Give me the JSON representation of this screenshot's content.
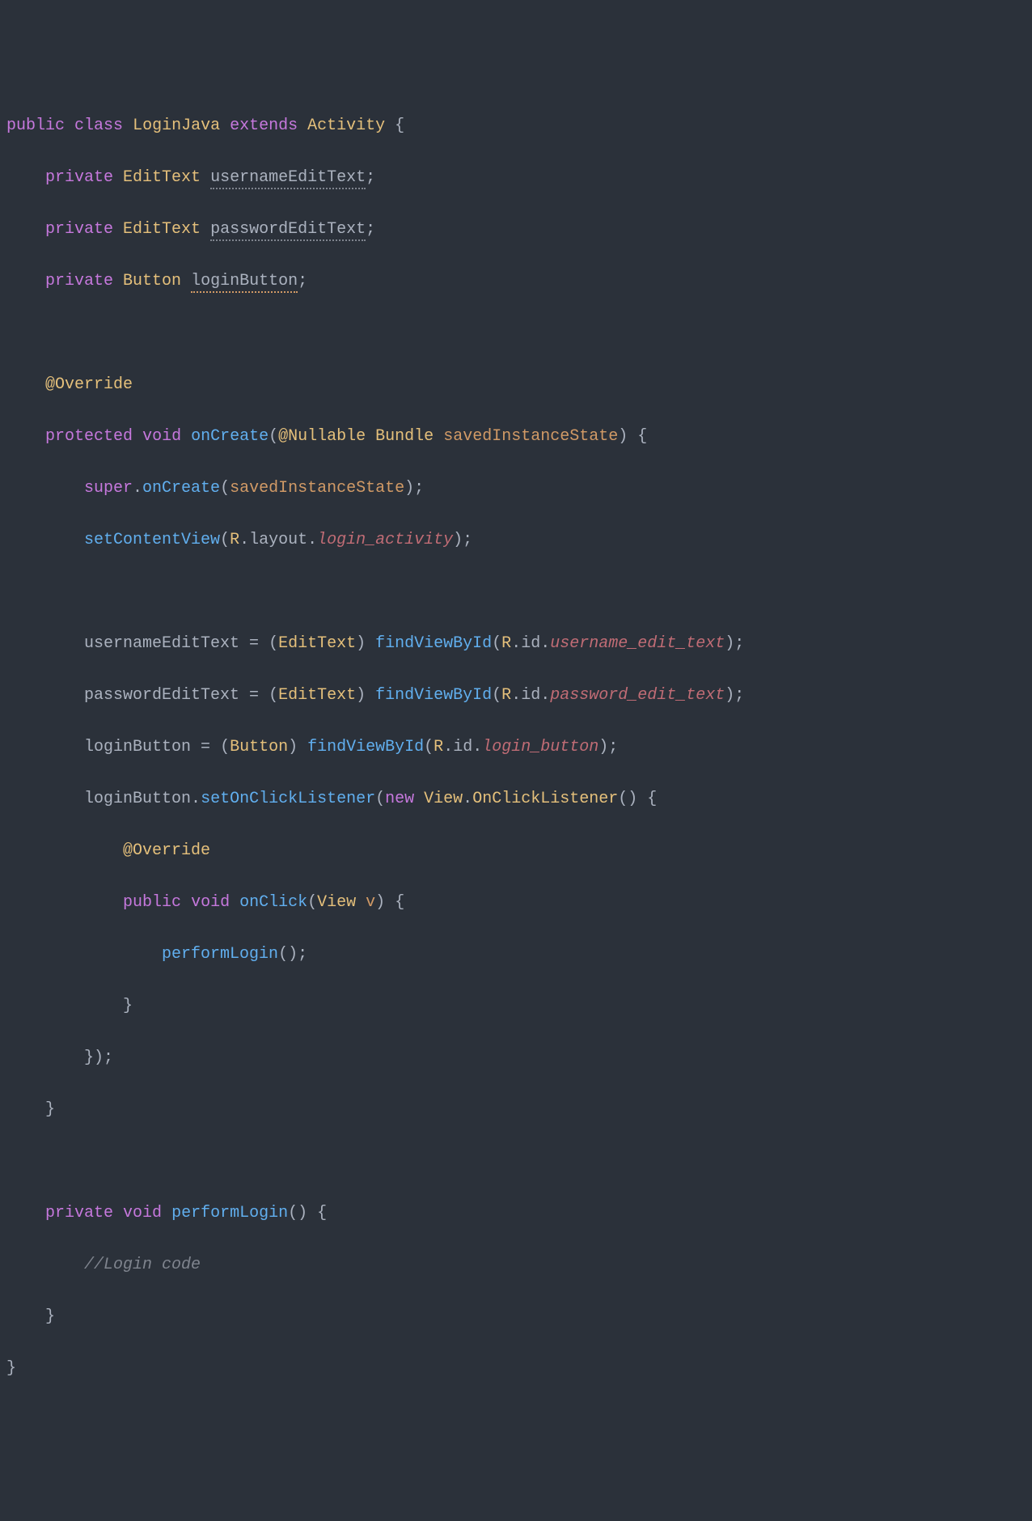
{
  "code": {
    "l1": {
      "kw1": "public",
      "kw2": "class",
      "name": "LoginJava",
      "kw3": "extends",
      "super": "Activity",
      "brace": "{"
    },
    "l2": {
      "kw": "private",
      "type": "EditText",
      "field": "usernameEditText",
      "semi": ";"
    },
    "l3": {
      "kw": "private",
      "type": "EditText",
      "field": "passwordEditText",
      "semi": ";"
    },
    "l4": {
      "kw": "private",
      "type": "Button",
      "field": "loginButton",
      "semi": ";"
    },
    "l6": {
      "ann": "@Override"
    },
    "l7": {
      "kw1": "protected",
      "kw2": "void",
      "method": "onCreate",
      "lp": "(",
      "ann": "@Nullable",
      "type": "Bundle",
      "param": "savedInstanceState",
      "rp": ")",
      "brace": "{"
    },
    "l8": {
      "sup": "super",
      "dot": ".",
      "method": "onCreate",
      "lp": "(",
      "param": "savedInstanceState",
      "rp": ")",
      "semi": ";"
    },
    "l9": {
      "method": "setContentView",
      "lp": "(",
      "r": "R",
      "dot1": ".",
      "layout": "layout",
      "dot2": ".",
      "res": "login_activity",
      "rp": ")",
      "semi": ";"
    },
    "l11": {
      "field": "usernameEditText",
      "eq": " = ",
      "lp": "(",
      "type": "EditText",
      "rp": ")",
      "method": "findViewById",
      "lp2": "(",
      "r": "R",
      "dot1": ".",
      "id": "id",
      "dot2": ".",
      "res": "username_edit_text",
      "rp2": ")",
      "semi": ";"
    },
    "l12": {
      "field": "passwordEditText",
      "eq": " = ",
      "lp": "(",
      "type": "EditText",
      "rp": ")",
      "method": "findViewById",
      "lp2": "(",
      "r": "R",
      "dot1": ".",
      "id": "id",
      "dot2": ".",
      "res": "password_edit_text",
      "rp2": ")",
      "semi": ";"
    },
    "l13": {
      "field": "loginButton",
      "eq": " = ",
      "lp": "(",
      "type": "Button",
      "rp": ")",
      "method": "findViewById",
      "lp2": "(",
      "r": "R",
      "dot1": ".",
      "id": "id",
      "dot2": ".",
      "res": "login_button",
      "rp2": ")",
      "semi": ";"
    },
    "l14": {
      "field": "loginButton",
      "dot": ".",
      "method": "setOnClickListener",
      "lp": "(",
      "kw": "new",
      "type1": "View",
      "dot2": ".",
      "type2": "OnClickListener",
      "lp2": "(",
      "rp2": ")",
      "brace": "{"
    },
    "l15": {
      "ann": "@Override"
    },
    "l16": {
      "kw1": "public",
      "kw2": "void",
      "method": "onClick",
      "lp": "(",
      "type": "View",
      "param": "v",
      "rp": ")",
      "brace": "{"
    },
    "l17": {
      "method": "performLogin",
      "lp": "(",
      "rp": ")",
      "semi": ";"
    },
    "l18": {
      "brace": "}"
    },
    "l19": {
      "brace": "}",
      "rp": ")",
      "semi": ";"
    },
    "l20": {
      "brace": "}"
    },
    "l22": {
      "kw1": "private",
      "kw2": "void",
      "method": "performLogin",
      "lp": "(",
      "rp": ")",
      "brace": "{"
    },
    "l23": {
      "comment": "//Login code"
    },
    "l24": {
      "brace": "}"
    },
    "l25": {
      "brace": "}"
    }
  }
}
